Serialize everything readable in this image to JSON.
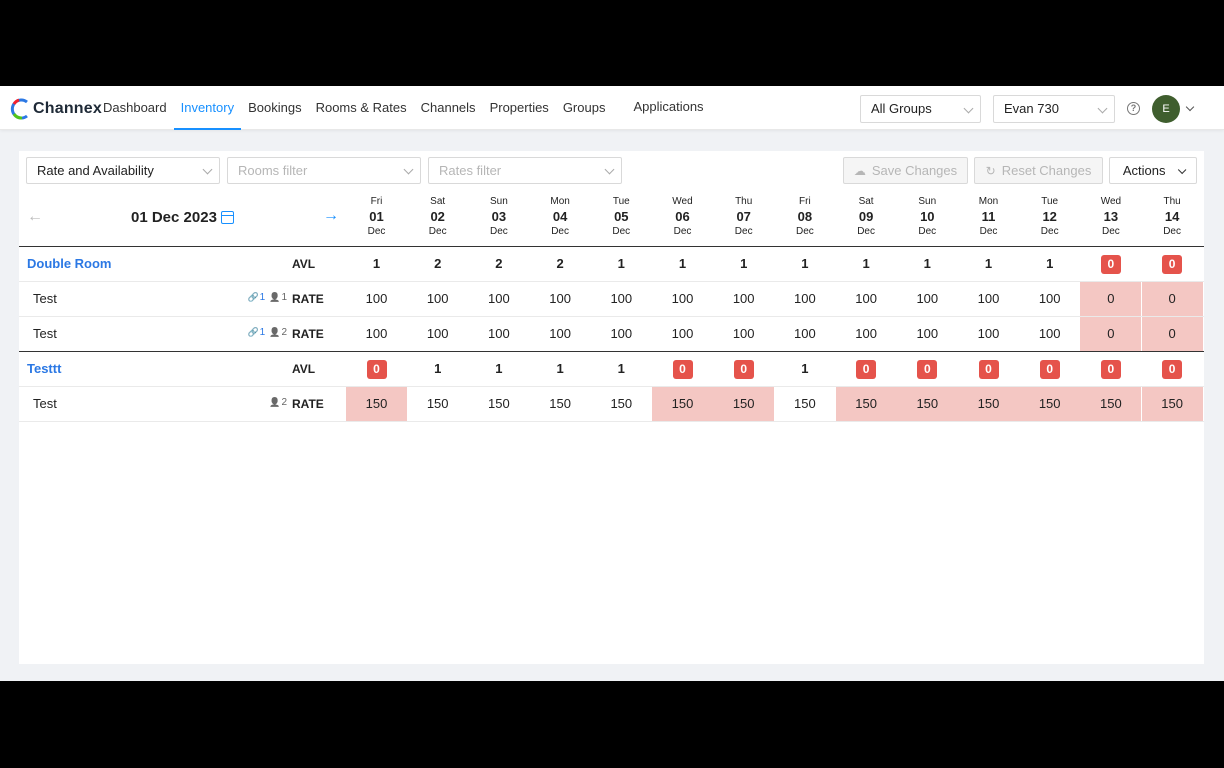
{
  "brand": {
    "name": "Channex"
  },
  "nav": {
    "items": [
      "Dashboard",
      "Inventory",
      "Bookings",
      "Rooms & Rates",
      "Channels",
      "Properties",
      "Groups"
    ],
    "active": "Inventory",
    "apps_label": "Applications"
  },
  "header": {
    "group_select": "All Groups",
    "property_select": "Evan 730",
    "help_icon": "question-circle-icon",
    "avatar_initial": "E"
  },
  "toolbar": {
    "mode_select": "Rate and Availability",
    "rooms_filter_placeholder": "Rooms filter",
    "rates_filter_placeholder": "Rates filter",
    "save_label": "Save Changes",
    "reset_label": "Reset Changes",
    "actions_label": "Actions"
  },
  "calendar": {
    "current_date": "01 Dec 2023",
    "days": [
      {
        "dow": "Fri",
        "num": "01",
        "mon": "Dec"
      },
      {
        "dow": "Sat",
        "num": "02",
        "mon": "Dec"
      },
      {
        "dow": "Sun",
        "num": "03",
        "mon": "Dec"
      },
      {
        "dow": "Mon",
        "num": "04",
        "mon": "Dec"
      },
      {
        "dow": "Tue",
        "num": "05",
        "mon": "Dec"
      },
      {
        "dow": "Wed",
        "num": "06",
        "mon": "Dec"
      },
      {
        "dow": "Thu",
        "num": "07",
        "mon": "Dec"
      },
      {
        "dow": "Fri",
        "num": "08",
        "mon": "Dec"
      },
      {
        "dow": "Sat",
        "num": "09",
        "mon": "Dec"
      },
      {
        "dow": "Sun",
        "num": "10",
        "mon": "Dec"
      },
      {
        "dow": "Mon",
        "num": "11",
        "mon": "Dec"
      },
      {
        "dow": "Tue",
        "num": "12",
        "mon": "Dec"
      },
      {
        "dow": "Wed",
        "num": "13",
        "mon": "Dec"
      },
      {
        "dow": "Thu",
        "num": "14",
        "mon": "Dec"
      }
    ]
  },
  "rooms": [
    {
      "name": "Double Room",
      "avl_label": "AVL",
      "avl": [
        "1",
        "2",
        "2",
        "2",
        "1",
        "1",
        "1",
        "1",
        "1",
        "1",
        "1",
        "1",
        "0",
        "0"
      ],
      "rates": [
        {
          "name": "Test",
          "linked": "1",
          "occupancy": "1",
          "type": "RATE",
          "values": [
            "100",
            "100",
            "100",
            "100",
            "100",
            "100",
            "100",
            "100",
            "100",
            "100",
            "100",
            "100",
            "0",
            "0"
          ]
        },
        {
          "name": "Test",
          "linked": "1",
          "occupancy": "2",
          "type": "RATE",
          "values": [
            "100",
            "100",
            "100",
            "100",
            "100",
            "100",
            "100",
            "100",
            "100",
            "100",
            "100",
            "100",
            "0",
            "0"
          ]
        }
      ]
    },
    {
      "name": "Testtt",
      "avl_label": "AVL",
      "avl": [
        "0",
        "1",
        "1",
        "1",
        "1",
        "0",
        "0",
        "1",
        "0",
        "0",
        "0",
        "0",
        "0",
        "0"
      ],
      "rates": [
        {
          "name": "Test",
          "linked": "",
          "occupancy": "2",
          "type": "RATE",
          "values": [
            "150",
            "150",
            "150",
            "150",
            "150",
            "150",
            "150",
            "150",
            "150",
            "150",
            "150",
            "150",
            "150",
            "150"
          ]
        }
      ]
    }
  ],
  "colors": {
    "accent": "#1890ff",
    "room_link": "#2b78e4",
    "zero_badge": "#e5534b",
    "closed_cell": "#f4c7c3"
  }
}
